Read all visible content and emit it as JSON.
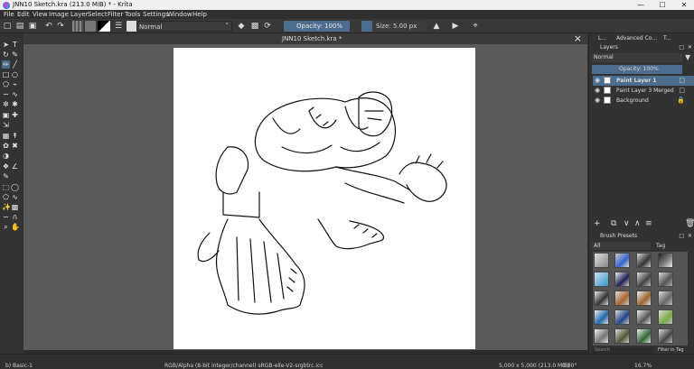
{
  "window": {
    "title": "JNN10 Sketch.kra (213.0 MiB)  * - Krita",
    "minimize": "—",
    "maximize": "☐",
    "close": "✕"
  },
  "menu": [
    "File",
    "Edit",
    "View",
    "Image",
    "Layer",
    "Select",
    "Filter",
    "Tools",
    "Settings",
    "Window",
    "Help"
  ],
  "toolbar": {
    "blend_mode": "Normal",
    "opacity": "Opacity: 100%",
    "size": "Size: 5.00 px"
  },
  "document": {
    "tab_title": "JNN10 Sketch.kra *"
  },
  "layers_dock": {
    "tabs": [
      "L...",
      "Advanced Co...",
      "T..."
    ],
    "title": "Layers",
    "blend_mode": "Normal",
    "opacity": "Opacity:  100%",
    "layers": [
      {
        "name": "Paint Layer 1",
        "selected": true
      },
      {
        "name": "Paint Layer 3 Merged",
        "selected": false
      },
      {
        "name": "Background",
        "selected": false
      }
    ]
  },
  "brush_presets": {
    "title": "Brush Presets",
    "filter": "All",
    "tag": "Tag",
    "search_placeholder": "Search",
    "filter_in_tag": "Filter in Tag"
  },
  "status": {
    "brush": "b) Basic-1",
    "color_info": "RGB/Alpha (8-bit integer/channel)  sRGB-elle-V2-srgbtrc.icc",
    "dimensions": "5,000 x 5,000 (213.0 MiB)",
    "rotation": "0.00°",
    "zoom": "16.7%"
  }
}
